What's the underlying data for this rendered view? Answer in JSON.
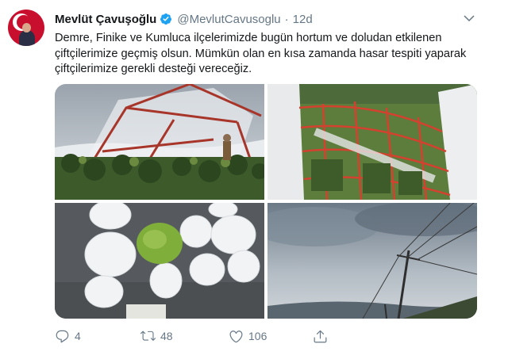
{
  "tweet": {
    "author_name": "Mevlüt Çavuşoğlu",
    "handle": "@MevlutCavusoglu",
    "separator": "·",
    "time": "12d",
    "text": "Demre, Finike ve Kumluca ilçelerimizde bugün hortum ve doludan etkilenen çiftçilerimize geçmiş olsun. Mümkün olan en kısa zamanda hasar tespiti yaparak çiftçilerimize gerekli desteği vereceğiz."
  },
  "icons": {
    "verified": "verified-badge-icon",
    "menu": "chevron-down-icon",
    "reply": "reply-icon",
    "retweet": "retweet-icon",
    "like": "heart-icon",
    "share": "share-icon"
  },
  "actions": {
    "reply_count": "4",
    "retweet_count": "48",
    "like_count": "106"
  },
  "colors": {
    "verified_blue": "#1da1f2",
    "muted_text": "#657786",
    "primary_text": "#14171a"
  }
}
